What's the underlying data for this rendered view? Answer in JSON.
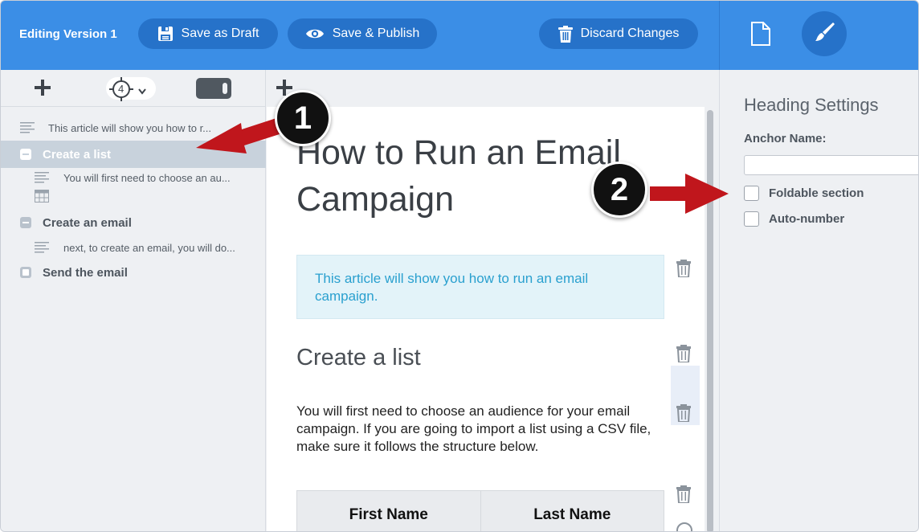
{
  "header": {
    "editing_label": "Editing Version 1",
    "save_draft_label": "Save as Draft",
    "publish_label": "Save & Publish",
    "discard_label": "Discard Changes"
  },
  "left_toolbar": {
    "level_value": "4"
  },
  "outline": {
    "items": [
      {
        "type": "paragraph",
        "text": "This article will show you how to r..."
      },
      {
        "type": "heading",
        "text": "Create a list",
        "active": true
      },
      {
        "type": "paragraph",
        "text": "You will first need to choose an au..."
      },
      {
        "type": "table",
        "text": ""
      },
      {
        "type": "heading",
        "text": "Create an email"
      },
      {
        "type": "paragraph",
        "text": "next, to create an email, you will do..."
      },
      {
        "type": "heading",
        "text": "Send the email"
      }
    ]
  },
  "document": {
    "title": "How to Run an Email Campaign",
    "callout": "This article will show you how to run an email campaign.",
    "section_heading": "Create a list",
    "paragraph": "You will first need to choose an audience for your email campaign. If you are going to import a list using a CSV file, make sure it follows the structure below.",
    "table_headers": [
      "First Name",
      "Last Name"
    ]
  },
  "settings": {
    "title": "Heading Settings",
    "anchor_label": "Anchor Name:",
    "anchor_value": "",
    "foldable_label": "Foldable section",
    "autonumber_label": "Auto-number",
    "foldable_checked": false,
    "autonumber_checked": false
  },
  "annotations": {
    "badge1": "1",
    "badge2": "2"
  },
  "colors": {
    "header_bg": "#3b8ee6",
    "pill_bg": "#2672c9",
    "arrow_red": "#c0161c",
    "callout_text": "#2aa0cf",
    "callout_bg": "#e3f3f9"
  }
}
